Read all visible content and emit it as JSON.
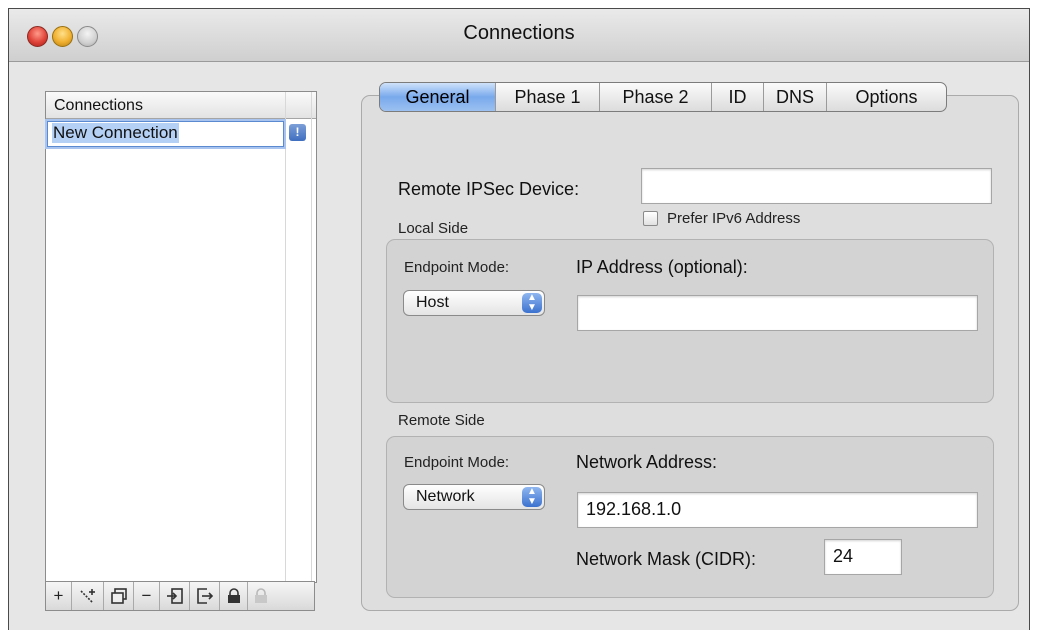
{
  "window": {
    "title": "Connections"
  },
  "sidebar": {
    "header": "Connections",
    "items": [
      {
        "label": "New Connection",
        "badge": "!"
      }
    ],
    "toolbar": [
      {
        "name": "add-connection-button",
        "glyph": "+",
        "enabled": true
      },
      {
        "name": "wizard-button",
        "glyph": "⋰⁺",
        "enabled": true
      },
      {
        "name": "duplicate-button",
        "glyph": "⧉",
        "enabled": true
      },
      {
        "name": "remove-button",
        "glyph": "−",
        "enabled": true
      },
      {
        "name": "import-button",
        "glyph": "⇲",
        "enabled": true
      },
      {
        "name": "export-button",
        "glyph": "⇥",
        "enabled": true
      },
      {
        "name": "lock-button",
        "glyph": "🔒",
        "enabled": true
      },
      {
        "name": "unlock-button",
        "glyph": "🔓",
        "enabled": false
      }
    ]
  },
  "tabs": [
    {
      "label": "General",
      "active": true
    },
    {
      "label": "Phase 1",
      "active": false
    },
    {
      "label": "Phase 2",
      "active": false
    },
    {
      "label": "ID",
      "active": false
    },
    {
      "label": "DNS",
      "active": false
    },
    {
      "label": "Options",
      "active": false
    }
  ],
  "general": {
    "remote_device_label": "Remote IPSec Device:",
    "remote_device_value": "",
    "prefer_ipv6_label": "Prefer IPv6 Address",
    "prefer_ipv6_checked": false,
    "local": {
      "section_label": "Local Side",
      "endpoint_mode_label": "Endpoint Mode:",
      "endpoint_mode_value": "Host",
      "ip_label": "IP Address (optional):",
      "ip_value": ""
    },
    "remote": {
      "section_label": "Remote Side",
      "endpoint_mode_label": "Endpoint Mode:",
      "endpoint_mode_value": "Network",
      "network_address_label": "Network Address:",
      "network_address_value": "192.168.1.0",
      "mask_label": "Network Mask (CIDR):",
      "mask_value": "24"
    }
  },
  "colors": {
    "selection": "#b5d0f5",
    "accent": "#3f6ec0"
  }
}
